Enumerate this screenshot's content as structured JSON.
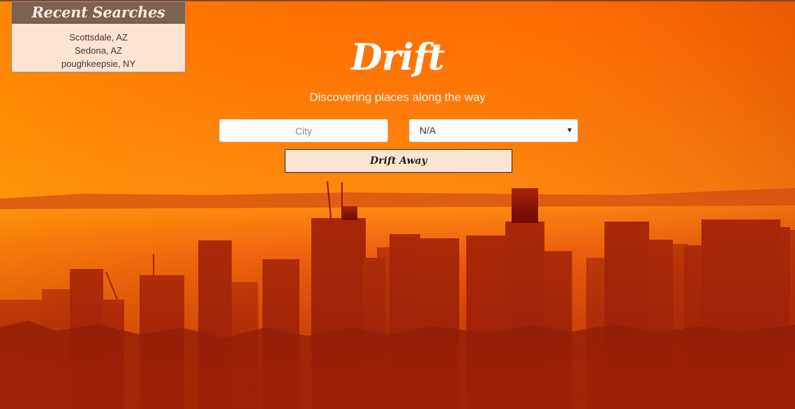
{
  "recent_searches": {
    "title": "Recent Searches",
    "items": [
      "Scottsdale, AZ",
      "Sedona, AZ",
      "poughkeepsie, NY"
    ]
  },
  "hero": {
    "brand": "Drift",
    "tagline": "Discovering places along the way"
  },
  "form": {
    "city_placeholder": "City",
    "state_selected": "N/A",
    "submit_label": "Drift Away"
  },
  "colors": {
    "panel_header": "#7b6253",
    "panel_body": "#fde3d2",
    "sky_top": "#ff6a00",
    "skyline": "#7a0d05"
  },
  "icons": {
    "select_caret": "chevron-down-icon"
  }
}
